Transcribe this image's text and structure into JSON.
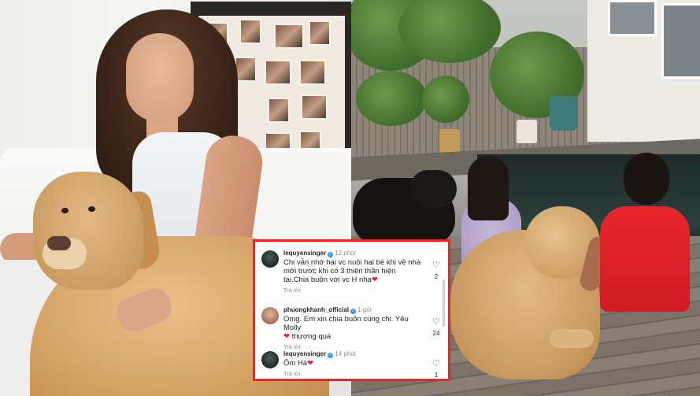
{
  "comments": [
    {
      "username": "lequyensinger",
      "time": "12 phút",
      "text": "Chị vẫn nhớ hai vc nuôi hai bé khi về nhà mới trước khi có 3 thiên thần hiện tại.Chia buồn với vc H nha",
      "reply_label": "Trả lời",
      "likes": "2"
    },
    {
      "username": "phuongkhanh_official",
      "time": "1 giờ",
      "text": "Omg. Em xin chia buồn cùng chị. Yêu Molly",
      "text_after_heart": "thương quá",
      "reply_label": "Trả lời",
      "likes": "24"
    },
    {
      "username": "lequyensinger",
      "time": "14 phút",
      "text": "Ôm Hà",
      "reply_label": "Trả lời",
      "likes": "1"
    }
  ],
  "colors": {
    "highlight_border": "#ff1e1e",
    "verified_badge": "#3897f0",
    "heart_emoji": "#ed1c3f"
  },
  "icons": [
    "heart-emoji-icon",
    "like-heart-outline-icon",
    "verified-badge-icon"
  ]
}
